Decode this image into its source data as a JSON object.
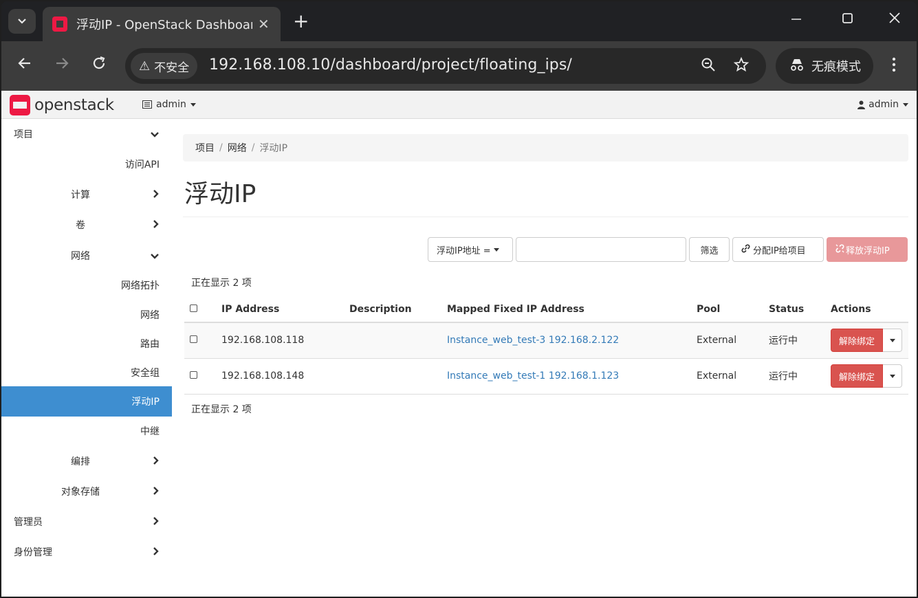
{
  "browser": {
    "tab_title": "浮动IP - OpenStack Dashboard",
    "url": "192.168.108.10/dashboard/project/floating_ips/",
    "security_label": "不安全",
    "incognito_label": "无痕模式",
    "newtab_glyph": "+",
    "close_glyph": "✕"
  },
  "navbar": {
    "logo_text": "openstack",
    "project_menu": "admin",
    "user_menu": "admin"
  },
  "sidebar": {
    "items": [
      {
        "label": "项目",
        "chevron": "down"
      },
      {
        "label": "访问API"
      },
      {
        "label": "计算",
        "chevron": "right"
      },
      {
        "label": "卷",
        "chevron": "right"
      },
      {
        "label": "网络",
        "chevron": "down"
      },
      {
        "label": "网络拓扑"
      },
      {
        "label": "网络"
      },
      {
        "label": "路由"
      },
      {
        "label": "安全组"
      },
      {
        "label": "浮动IP",
        "active": true
      },
      {
        "label": "中继"
      },
      {
        "label": "编排",
        "chevron": "right"
      },
      {
        "label": "对象存储",
        "chevron": "right"
      },
      {
        "label": "管理员",
        "chevron": "right"
      },
      {
        "label": "身份管理",
        "chevron": "right"
      }
    ]
  },
  "breadcrumb": {
    "items": [
      "项目",
      "网络",
      "浮动IP"
    ]
  },
  "page_title": "浮动IP",
  "filter": {
    "field_label": "浮动IP地址 =",
    "input_value": "",
    "filter_button": "筛选",
    "allocate_button": "分配IP给项目",
    "release_button": "释放浮动IP"
  },
  "count_text": "正在显示 2 项",
  "table": {
    "headers": [
      "IP Address",
      "Description",
      "Mapped Fixed IP Address",
      "Pool",
      "Status",
      "Actions"
    ],
    "rows": [
      {
        "ip": "192.168.108.118",
        "description": "",
        "mapped": "Instance_web_test-3 192.168.2.122",
        "pool": "External",
        "status": "运行中",
        "action": "解除绑定"
      },
      {
        "ip": "192.168.108.148",
        "description": "",
        "mapped": "Instance_web_test-1 192.168.1.123",
        "pool": "External",
        "status": "运行中",
        "action": "解除绑定"
      }
    ]
  }
}
